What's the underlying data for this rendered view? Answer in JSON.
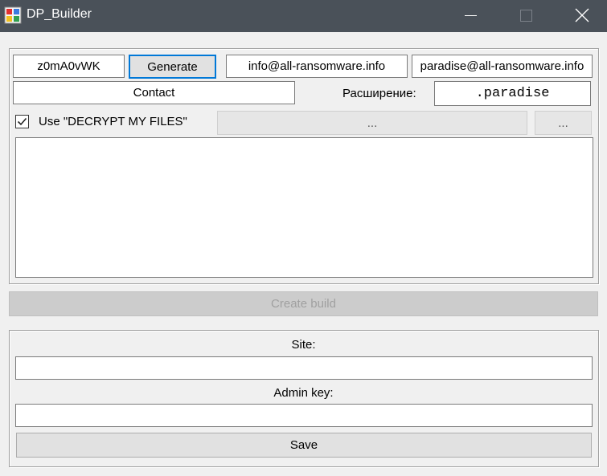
{
  "window": {
    "title": "DP_Builder",
    "controls": {
      "minimize": "minimize-icon",
      "maximize": "maximize-icon",
      "close": "close-icon"
    }
  },
  "builder": {
    "key_value": "z0mA0vWK",
    "generate_label": "Generate",
    "email1_value": "info@all-ransomware.info",
    "email2_value": "paradise@all-ransomware.info",
    "contact_value": "Contact",
    "extension_label": "Расширение:",
    "extension_value": ".paradise",
    "decrypt_checkbox_label": "Use \"DECRYPT MY FILES\"",
    "decrypt_checked": true,
    "decrypt_path_value": "...",
    "browse_label": "...",
    "notes_value": ""
  },
  "create_build_label": "Create build",
  "server": {
    "site_label": "Site:",
    "site_value": "",
    "admin_key_label": "Admin key:",
    "admin_key_value": "",
    "save_label": "Save"
  },
  "colors": {
    "titlebar": "#4a5159",
    "window_bg": "#f0f0f0",
    "focus_border": "#0078d7",
    "button_bg": "#e1e1e1",
    "disabled_button_bg": "#cccccc"
  }
}
